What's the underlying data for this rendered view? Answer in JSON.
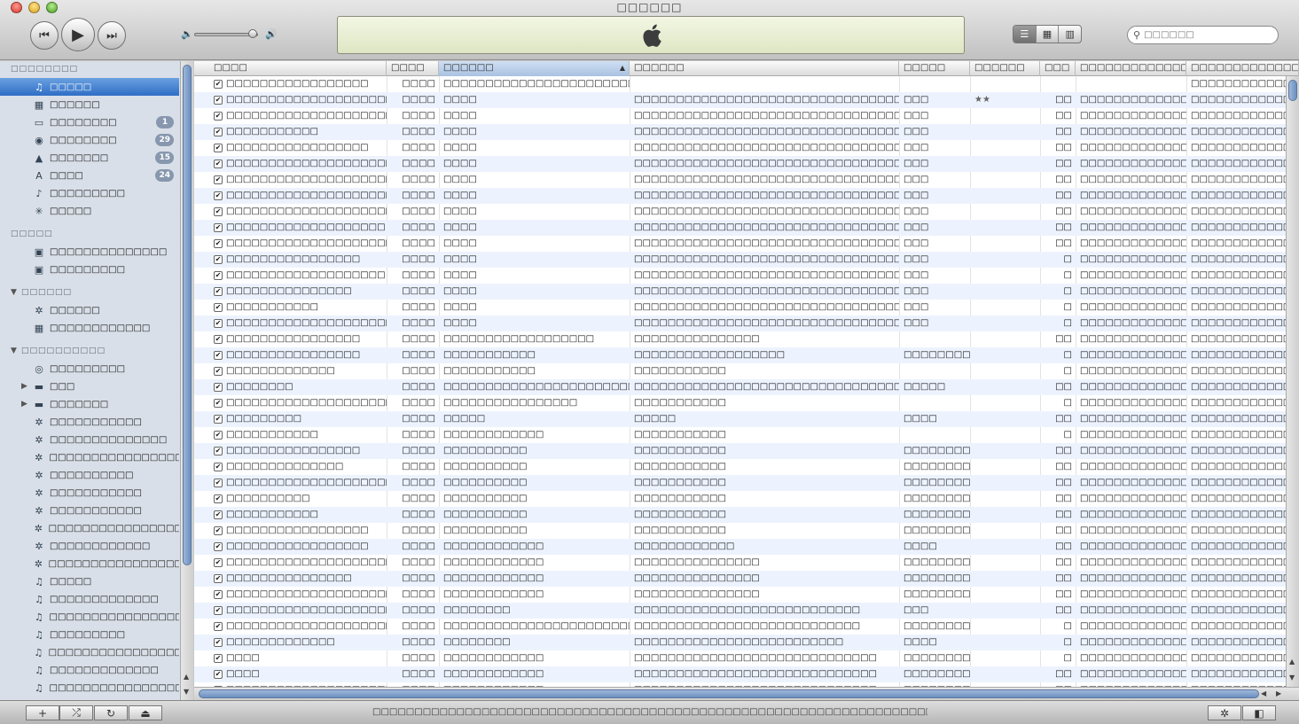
{
  "window": {
    "title": "□□□□□□"
  },
  "controls": {
    "prev_icon": "⏮",
    "play_icon": "▶",
    "next_icon": "⏭",
    "volume_low_icon": "🔈",
    "volume_high_icon": "🔊",
    "volume_level": 0.92
  },
  "view_buttons": {
    "list": "☰",
    "grid": "▦",
    "coverflow": "▥"
  },
  "search": {
    "placeholder": "□□□□□□"
  },
  "sidebar": {
    "library_header": "□□□□□□□□",
    "library": [
      {
        "label": "□□□□□",
        "icon": "♫",
        "selected": true
      },
      {
        "label": "□□□□□□",
        "icon": "▦"
      },
      {
        "label": "□□□□□□□□",
        "icon": "▭",
        "badge": "1"
      },
      {
        "label": "□□□□□□□□",
        "icon": "◉",
        "badge": "29"
      },
      {
        "label": "□□□□□□□",
        "icon": "▲",
        "badge": "15"
      },
      {
        "label": "□□□□",
        "icon": "A",
        "badge": "24"
      },
      {
        "label": "□□□□□□□□□",
        "icon": "♪"
      },
      {
        "label": "□□□□□",
        "icon": "✳"
      }
    ],
    "store_header": "□□□□□",
    "store": [
      {
        "label": "□□□□□□□□□□□□□□",
        "icon": "▣"
      },
      {
        "label": "□□□□□□□□□",
        "icon": "▣"
      }
    ],
    "genius_header": "□□□□□□",
    "genius": [
      {
        "label": "□□□□□□",
        "icon": "✲"
      },
      {
        "label": "□□□□□□□□□□□□",
        "icon": "▦"
      }
    ],
    "playlists_header": "□□□□□□□□□□",
    "playlists": [
      {
        "label": "□□□□□□□□□",
        "icon": "◎"
      },
      {
        "label": "□□□",
        "icon": "▬",
        "folder": true
      },
      {
        "label": "□□□□□□□",
        "icon": "▬",
        "folder": true
      },
      {
        "label": "□□□□□□□□□□□",
        "icon": "✲"
      },
      {
        "label": "□□□□□□□□□□□□□□",
        "icon": "✲"
      },
      {
        "label": "□□□□□□□□□□□□□□□□",
        "icon": "✲"
      },
      {
        "label": "□□□□□□□□□□",
        "icon": "✲"
      },
      {
        "label": "□□□□□□□□□□□",
        "icon": "✲"
      },
      {
        "label": "□□□□□□□□□□□",
        "icon": "✲"
      },
      {
        "label": "□□□□□□□□□□□□□□□□□",
        "icon": "✲"
      },
      {
        "label": "□□□□□□□□□□□□",
        "icon": "✲"
      },
      {
        "label": "□□□□□□□□□□□□□□□□□",
        "icon": "✲"
      },
      {
        "label": "□□□□□",
        "icon": "♫"
      },
      {
        "label": "□□□□□□□□□□□□□",
        "icon": "♫"
      },
      {
        "label": "□□□□□□□□□□□□□□□□",
        "icon": "♫"
      },
      {
        "label": "□□□□□□□□□",
        "icon": "♫"
      },
      {
        "label": "□□□□□□□□□□□□□□□□□",
        "icon": "♫"
      },
      {
        "label": "□□□□□□□□□□□□□",
        "icon": "♫"
      },
      {
        "label": "□□□□□□□□□□□□□□□□",
        "icon": "♫"
      }
    ]
  },
  "columns": [
    "□□□□",
    "□□□□",
    "□□□□□□",
    "□□□□□□",
    "□□□□□",
    "□□□□□□",
    "□□□",
    "□□□□□□□□□□□□□",
    "□□□□□□□□□□□□□"
  ],
  "sort_indicator": "▲",
  "check_glyph": "✔",
  "tracks": [
    [
      "□□□□□□□□□□□□□□□□□",
      "□□□□",
      "□□□□□□□□□□□□□□□□□□□□□□□□□□□□",
      "",
      "",
      "",
      "",
      "",
      "□□□□□□□□□□□□□□□"
    ],
    [
      "□□□□□□□□□□□□□□□□□□□□□□□□",
      "□□□□",
      "□□□□",
      "□□□□□□□□□□□□□□□□□□□□□□□□□□□□□□□□□□",
      "□□□",
      "★★",
      "□□",
      "□□□□□□□□□□□□□",
      "□□□□□□□□□□□□□□□"
    ],
    [
      "□□□□□□□□□□□□□□□□□□□□□□□□",
      "□□□□",
      "□□□□",
      "□□□□□□□□□□□□□□□□□□□□□□□□□□□□□□□□□□",
      "□□□",
      "",
      "□□",
      "□□□□□□□□□□□□□",
      "□□□□□□□□□□□□□□□"
    ],
    [
      "□□□□□□□□□□□",
      "□□□□",
      "□□□□",
      "□□□□□□□□□□□□□□□□□□□□□□□□□□□□□□□□□□",
      "□□□",
      "",
      "□□",
      "□□□□□□□□□□□□□",
      "□□□□□□□□□□□□□□□"
    ],
    [
      "□□□□□□□□□□□□□□□□□",
      "□□□□",
      "□□□□",
      "□□□□□□□□□□□□□□□□□□□□□□□□□□□□□□□□□□",
      "□□□",
      "",
      "□□",
      "□□□□□□□□□□□□□",
      "□□□□□□□□□□□□□□□"
    ],
    [
      "□□□□□□□□□□□□□□□□□□□□□□□□",
      "□□□□",
      "□□□□",
      "□□□□□□□□□□□□□□□□□□□□□□□□□□□□□□□□□□",
      "□□□",
      "",
      "□□",
      "□□□□□□□□□□□□□",
      "□□□□□□□□□□□□□□□"
    ],
    [
      "□□□□□□□□□□□□□□□□□□□□□□□□",
      "□□□□",
      "□□□□",
      "□□□□□□□□□□□□□□□□□□□□□□□□□□□□□□□□□□",
      "□□□",
      "",
      "□□",
      "□□□□□□□□□□□□□",
      "□□□□□□□□□□□□□□□"
    ],
    [
      "□□□□□□□□□□□□□□□□□□□□□□□□",
      "□□□□",
      "□□□□",
      "□□□□□□□□□□□□□□□□□□□□□□□□□□□□□□□□□□",
      "□□□",
      "",
      "□□",
      "□□□□□□□□□□□□□",
      "□□□□□□□□□□□□□□□"
    ],
    [
      "□□□□□□□□□□□□□□□□□□□□□□□□",
      "□□□□",
      "□□□□",
      "□□□□□□□□□□□□□□□□□□□□□□□□□□□□□□□□□□",
      "□□□",
      "",
      "□□",
      "□□□□□□□□□□□□□",
      "□□□□□□□□□□□□□□□"
    ],
    [
      "□□□□□□□□□□□□□□□□□□□",
      "□□□□",
      "□□□□",
      "□□□□□□□□□□□□□□□□□□□□□□□□□□□□□□□□□□",
      "□□□",
      "",
      "□□",
      "□□□□□□□□□□□□□",
      "□□□□□□□□□□□□□□□"
    ],
    [
      "□□□□□□□□□□□□□□□□□□□□□□□□",
      "□□□□",
      "□□□□",
      "□□□□□□□□□□□□□□□□□□□□□□□□□□□□□□□□□□",
      "□□□",
      "",
      "□□",
      "□□□□□□□□□□□□□",
      "□□□□□□□□□□□□□□□"
    ],
    [
      "□□□□□□□□□□□□□□□□",
      "□□□□",
      "□□□□",
      "□□□□□□□□□□□□□□□□□□□□□□□□□□□□□□□□□□",
      "□□□",
      "",
      "□",
      "□□□□□□□□□□□□□",
      "□□□□□□□□□□□□□□□"
    ],
    [
      "□□□□□□□□□□□□□□□□□□□",
      "□□□□",
      "□□□□",
      "□□□□□□□□□□□□□□□□□□□□□□□□□□□□□□□□□□",
      "□□□",
      "",
      "□",
      "□□□□□□□□□□□□□",
      "□□□□□□□□□□□□□□□"
    ],
    [
      "□□□□□□□□□□□□□□□",
      "□□□□",
      "□□□□",
      "□□□□□□□□□□□□□□□□□□□□□□□□□□□□□□□□□□",
      "□□□",
      "",
      "□",
      "□□□□□□□□□□□□□",
      "□□□□□□□□□□□□□□□"
    ],
    [
      "□□□□□□□□□□□",
      "□□□□",
      "□□□□",
      "□□□□□□□□□□□□□□□□□□□□□□□□□□□□□□□□□□",
      "□□□",
      "",
      "□",
      "□□□□□□□□□□□□□",
      "□□□□□□□□□□□□□□□"
    ],
    [
      "□□□□□□□□□□□□□□□□□□□□□□□□",
      "□□□□",
      "□□□□",
      "□□□□□□□□□□□□□□□□□□□□□□□□□□□□□□□□□□",
      "□□□",
      "",
      "□",
      "□□□□□□□□□□□□□",
      "□□□□□□□□□□□□□□□"
    ],
    [
      "□□□□□□□□□□□□□□□□",
      "□□□□",
      "□□□□□□□□□□□□□□□□□□",
      "□□□□□□□□□□□□□□□",
      "",
      "",
      "□□",
      "□□□□□□□□□□□□□",
      "□□□□□□□□□□□□□□□"
    ],
    [
      "□□□□□□□□□□□□□□□□",
      "□□□□",
      "□□□□□□□□□□□",
      "□□□□□□□□□□□□□□□□□□",
      "□□□□□□□□",
      "",
      "□",
      "□□□□□□□□□□□□□",
      "□□□□□□□□□□□□□□□"
    ],
    [
      "□□□□□□□□□□□□□",
      "□□□□",
      "□□□□□□□□□□□",
      "□□□□□□□□□□□",
      "",
      "",
      "□",
      "□□□□□□□□□□□□□",
      "□□□□□□□□□□□□□□□"
    ],
    [
      "□□□□□□□□",
      "□□□□",
      "□□□□□□□□□□□□□□□□□□□□□□□□□□",
      "□□□□□□□□□□□□□□□□□□□□□□□□□□□□□□□□□□□□□□",
      "□□□□□",
      "",
      "□□",
      "□□□□□□□□□□□□□",
      "□□□□□□□□□□□□□□□"
    ],
    [
      "□□□□□□□□□□□□□□□□□□□□□□□□",
      "□□□□",
      "□□□□□□□□□□□□□□□□",
      "□□□□□□□□□□□",
      "",
      "",
      "□",
      "□□□□□□□□□□□□□",
      "□□□□□□□□□□□□□□□"
    ],
    [
      "□□□□□□□□□",
      "□□□□",
      "□□□□□",
      "□□□□□",
      "□□□□",
      "",
      "□□",
      "□□□□□□□□□□□□□",
      "□□□□□□□□□□□□□□□"
    ],
    [
      "□□□□□□□□□□□",
      "□□□□",
      "□□□□□□□□□□□□",
      "□□□□□□□□□□□",
      "",
      "",
      "□",
      "□□□□□□□□□□□□□",
      "□□□□□□□□□□□□□□□"
    ],
    [
      "□□□□□□□□□□□□□□□□",
      "□□□□",
      "□□□□□□□□□□",
      "□□□□□□□□□□□",
      "□□□□□□□□",
      "",
      "□□",
      "□□□□□□□□□□□□□",
      "□□□□□□□□□□□□□□□"
    ],
    [
      "□□□□□□□□□□□□□□",
      "□□□□",
      "□□□□□□□□□□",
      "□□□□□□□□□□□",
      "□□□□□□□□",
      "",
      "□□",
      "□□□□□□□□□□□□□",
      "□□□□□□□□□□□□□□□"
    ],
    [
      "□□□□□□□□□□□□□□□□□□□□□□□□",
      "□□□□",
      "□□□□□□□□□□",
      "□□□□□□□□□□□",
      "□□□□□□□□",
      "",
      "□□",
      "□□□□□□□□□□□□□",
      "□□□□□□□□□□□□□□□"
    ],
    [
      "□□□□□□□□□□",
      "□□□□",
      "□□□□□□□□□□",
      "□□□□□□□□□□□",
      "□□□□□□□□",
      "",
      "□□",
      "□□□□□□□□□□□□□",
      "□□□□□□□□□□□□□□□"
    ],
    [
      "□□□□□□□□□□□",
      "□□□□",
      "□□□□□□□□□□",
      "□□□□□□□□□□□",
      "□□□□□□□□",
      "",
      "□□",
      "□□□□□□□□□□□□□",
      "□□□□□□□□□□□□□□□"
    ],
    [
      "□□□□□□□□□□□□□□□□□",
      "□□□□",
      "□□□□□□□□□□",
      "□□□□□□□□□□□",
      "□□□□□□□□",
      "",
      "□□",
      "□□□□□□□□□□□□□",
      "□□□□□□□□□□□□□□□"
    ],
    [
      "□□□□□□□□□□□□□□□□□",
      "□□□□",
      "□□□□□□□□□□□□",
      "□□□□□□□□□□□□",
      "□□□□",
      "",
      "□□",
      "□□□□□□□□□□□□□",
      "□□□□□□□□□□□□□□□"
    ],
    [
      "□□□□□□□□□□□□□□□□□□□□□□□□",
      "□□□□",
      "□□□□□□□□□□□□",
      "□□□□□□□□□□□□□□□",
      "□□□□□□□□",
      "",
      "□□",
      "□□□□□□□□□□□□□",
      "□□□□□□□□□□□□□□□"
    ],
    [
      "□□□□□□□□□□□□□□□",
      "□□□□",
      "□□□□□□□□□□□□",
      "□□□□□□□□□□□□□□□",
      "□□□□□□□□",
      "",
      "□□",
      "□□□□□□□□□□□□□",
      "□□□□□□□□□□□□□□□"
    ],
    [
      "□□□□□□□□□□□□□□□□□□□□□□□□",
      "□□□□",
      "□□□□□□□□□□□□",
      "□□□□□□□□□□□□□□□",
      "□□□□□□□□",
      "",
      "□□",
      "□□□□□□□□□□□□□",
      "□□□□□□□□□□□□□□□"
    ],
    [
      "□□□□□□□□□□□□□□□□□□□□",
      "□□□□",
      "□□□□□□□□",
      "□□□□□□□□□□□□□□□□□□□□□□□□□□□",
      "□□□",
      "",
      "□□",
      "□□□□□□□□□□□□□",
      "□□□□□□□□□□□□□□□"
    ],
    [
      "□□□□□□□□□□□□□□□□□□□□□□□□",
      "□□□□",
      "□□□□□□□□□□□□□□□□□□□□□□□□□□",
      "□□□□□□□□□□□□□□□□□□□□□□□□□□□",
      "□□□□□□□□",
      "",
      "□",
      "□□□□□□□□□□□□□",
      "□□□□□□□□□□□□□□□"
    ],
    [
      "□□□□□□□□□□□□□",
      "□□□□",
      "□□□□□□□□",
      "□□□□□□□□□□□□□□□□□□□□□□□□□",
      "□□□□",
      "",
      "□",
      "□□□□□□□□□□□□□",
      "□□□□□□□□□□□□□□□"
    ],
    [
      "□□□□",
      "□□□□",
      "□□□□□□□□□□□□",
      "□□□□□□□□□□□□□□□□□□□□□□□□□□□□□",
      "□□□□□□□□",
      "",
      "□",
      "□□□□□□□□□□□□□",
      "□□□□□□□□□□□□□□□"
    ],
    [
      "□□□□",
      "□□□□",
      "□□□□□□□□□□□□",
      "□□□□□□□□□□□□□□□□□□□□□□□□□□□□□",
      "□□□□□□□□",
      "",
      "□□",
      "□□□□□□□□□□□□□",
      "□□□□□□□□□□□□□□□"
    ],
    [
      "□□□□□□□□□□□□□□□□□□□□□□□□",
      "□□□□",
      "□□□□□□□□□□□□",
      "□□□□□□□□□□□□□□□□□□□□□□□□□□□□□",
      "□□□□□□□□",
      "",
      "□□",
      "□□□□□□□□□□□□□",
      "□□□□□□□□□□□□□□□"
    ]
  ],
  "bottom": {
    "add_icon": "+",
    "shuffle_icon": "⤮",
    "repeat_icon": "↻",
    "artwork_icon": "⏏",
    "status": "□□□□□□□□□□□□□□□□□□□□□□□□□□□□□□□□□□□□□□□□□□□□□□□□□□□□□□□□□□□□□□□□□□□□□□",
    "genius_icon": "✲",
    "minimize_icon": "◧"
  }
}
